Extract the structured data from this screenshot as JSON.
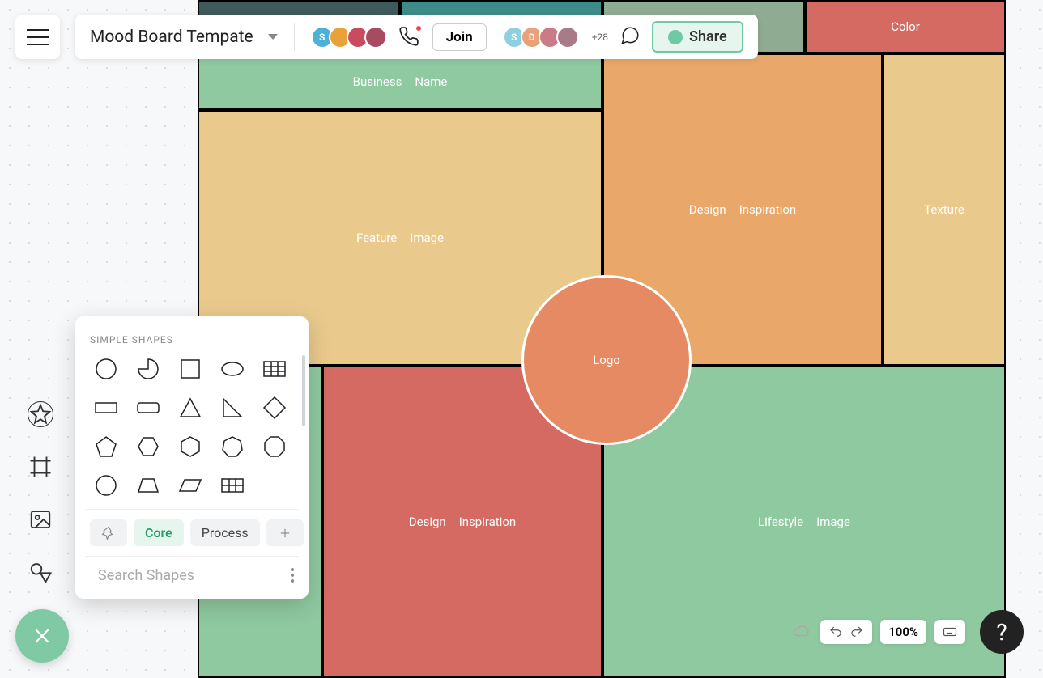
{
  "header": {
    "doc_title": "Mood Board Tempate",
    "join_label": "Join",
    "share_label": "Share",
    "avatars_left": [
      "S",
      "",
      "",
      ""
    ],
    "avatars_right": [
      "S",
      "D",
      "",
      ""
    ],
    "plus_count": "+28",
    "avatar_colors_left": [
      "#4fb0d6",
      "#e9a23a",
      "#c94b60",
      "#c94b60"
    ],
    "avatar_colors_right": [
      "#8fd0e0",
      "#e9a17a",
      "#c97b88",
      "#c97b88"
    ]
  },
  "board": {
    "tiles": {
      "top_left": {
        "color": "#3e5a5a"
      },
      "top_mid": {
        "color": "#3d8c87"
      },
      "top_right": {
        "color": "#8fab91"
      },
      "color": {
        "color": "#d46a62",
        "label1": "Color",
        "label2": ""
      },
      "business": {
        "color": "#8fc9a0",
        "label1": "Business",
        "label2": "Name"
      },
      "feature": {
        "color": "#e9c98c",
        "label1": "Feature",
        "label2": "Image"
      },
      "design1": {
        "color": "#e9a869",
        "label1": "Design",
        "label2": "Inspiration"
      },
      "texture": {
        "color": "#e9c98c",
        "label1": "Texture",
        "label2": ""
      },
      "design2": {
        "color": "#d46a62",
        "label1": "Design",
        "label2": "Inspiration"
      },
      "lifestyle": {
        "color": "#8fc9a0",
        "label1": "Lifestyle",
        "label2": "Image"
      },
      "bottom_left": {
        "color": "#8fc9a0"
      }
    },
    "logo_label": "Logo"
  },
  "shapes_panel": {
    "title": "SIMPLE SHAPES",
    "tabs": {
      "core": "Core",
      "process": "Process"
    },
    "search_placeholder": "Search Shapes"
  },
  "bottom": {
    "zoom": "100%",
    "help": "?"
  }
}
